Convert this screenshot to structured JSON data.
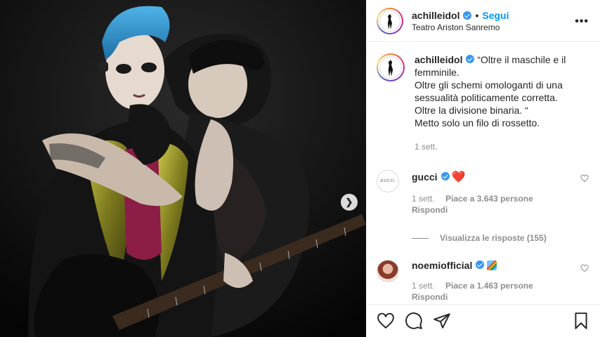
{
  "post": {
    "username": "achilleidol",
    "follow_label": "Segui",
    "separator": "•",
    "location": "Teatro Ariston Sanremo",
    "more_label": "•••"
  },
  "caption": {
    "username": "achilleidol",
    "lines": [
      "“Oltre il maschile e il femminile.",
      "Oltre gli schemi omologanti di una sessualità politicamente corretta.",
      "Oltre la divisione binaria. “",
      "Metto solo un filo di rossetto."
    ],
    "time": "1 sett."
  },
  "comments": [
    {
      "username": "gucci",
      "avatar_text": "GUCCI",
      "text": "❤️",
      "time": "1 sett.",
      "likes": "Piace a 3.643 persone",
      "reply": "Rispondi"
    },
    {
      "username": "noemiofficial",
      "avatar_text": "",
      "text": "",
      "time": "1 sett.",
      "likes": "Piace a 1.463 persone",
      "reply": "Rispondi"
    }
  ],
  "view_replies": "Visualizza le risposte (155)",
  "colors": {
    "accent": "#0095f6",
    "verified": "#3897f0",
    "meta": "#8e8e8e",
    "heart": "#ed2b3b"
  },
  "icons": [
    "heart-icon",
    "comment-icon",
    "share-icon",
    "bookmark-icon",
    "more-options-icon",
    "next-arrow-icon",
    "verified-badge-icon"
  ]
}
